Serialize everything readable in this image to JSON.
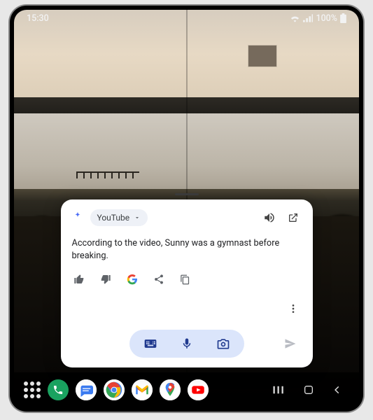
{
  "statusbar": {
    "time": "15:30",
    "battery": "100%"
  },
  "card": {
    "chip_label": "YouTube",
    "answer": "According to the video, Sunny was a gymnast before breaking."
  },
  "taskbar": {
    "apps": [
      "Phone",
      "Messages",
      "Chrome",
      "Gmail",
      "Maps",
      "YouTube"
    ]
  }
}
